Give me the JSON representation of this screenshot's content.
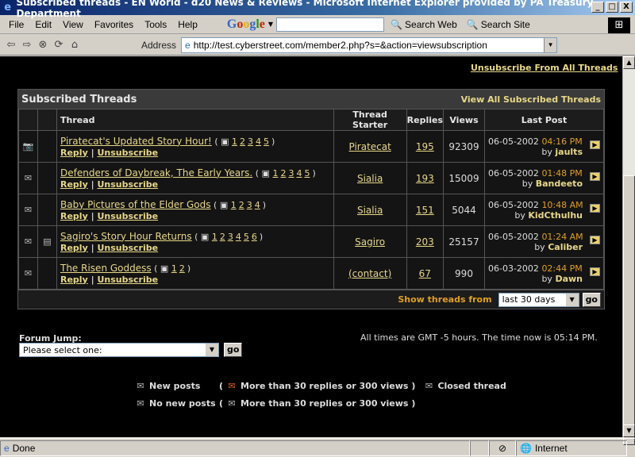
{
  "window": {
    "title": "Subscribed threads - EN World - d20 News & Reviews - Microsoft Internet Explorer provided by PA Treasury Department",
    "controls": [
      "_",
      "□",
      "X"
    ]
  },
  "menu": [
    "File",
    "Edit",
    "View",
    "Favorites",
    "Tools",
    "Help"
  ],
  "google": {
    "logo": "Google",
    "search_web": "Search Web",
    "search_site": "Search Site"
  },
  "address": {
    "label": "Address",
    "url": "http://test.cyberstreet.com/member2.php?s=&action=viewsubscription"
  },
  "page": {
    "unsubscribe_all": "Unsubscribe From All Threads",
    "table_title": "Subscribed Threads",
    "view_all": "View All Subscribed Threads",
    "columns": [
      "Thread",
      "Thread Starter",
      "Replies",
      "Views",
      "Last Post"
    ],
    "threads": [
      {
        "title": "Piratecat's Updated Story Hour!",
        "pages": [
          "1",
          "2",
          "3",
          "4",
          "5"
        ],
        "starter": "Piratecat",
        "replies": "195",
        "views": "92309",
        "date": "06-05-2002",
        "time": "04:16 PM",
        "by": "jaults",
        "icon": "new-posts",
        "icon2": ""
      },
      {
        "title": "Defenders of Daybreak, The Early Years.",
        "pages": [
          "1",
          "2",
          "3",
          "4",
          "5"
        ],
        "starter": "Sialia",
        "replies": "193",
        "views": "15009",
        "date": "06-05-2002",
        "time": "01:48 PM",
        "by": "Bandeeto",
        "icon": "no-new-posts",
        "icon2": ""
      },
      {
        "title": "Baby Pictures of the Elder Gods",
        "pages": [
          "1",
          "2",
          "3",
          "4"
        ],
        "starter": "Sialia",
        "replies": "151",
        "views": "5044",
        "date": "06-05-2002",
        "time": "10:48 AM",
        "by": "KidCthulhu",
        "icon": "no-new-posts",
        "icon2": ""
      },
      {
        "title": "Sagiro's Story Hour Returns",
        "pages": [
          "1",
          "2",
          "3",
          "4",
          "5",
          "6"
        ],
        "starter": "Sagiro",
        "replies": "203",
        "views": "25157",
        "date": "06-05-2002",
        "time": "01:24 AM",
        "by": "Caliber",
        "icon": "no-new-posts",
        "icon2": "document"
      },
      {
        "title": "The Risen Goddess",
        "pages": [
          "1",
          "2"
        ],
        "starter": "(contact)",
        "replies": "67",
        "views": "990",
        "date": "06-03-2002",
        "time": "02:44 PM",
        "by": "Dawn",
        "icon": "no-new-posts",
        "icon2": ""
      }
    ],
    "reply": "Reply",
    "unsubscribe": "Unsubscribe",
    "by_prefix": "by",
    "show_threads_from": "Show threads from",
    "period": "last 30 days",
    "go": "go",
    "forum_jump": "Forum Jump:",
    "forum_select": "Please select one:",
    "times": "All times are GMT -5 hours. The time now is 05:14 PM.",
    "legend": {
      "new_posts": "New posts",
      "hot_new": "More than 30 replies or 300 views",
      "closed": "Closed thread",
      "no_new_posts": "No new posts",
      "hot_no_new": "More than 30 replies or 300 views"
    }
  },
  "status": {
    "done": "Done",
    "zone": "Internet"
  }
}
